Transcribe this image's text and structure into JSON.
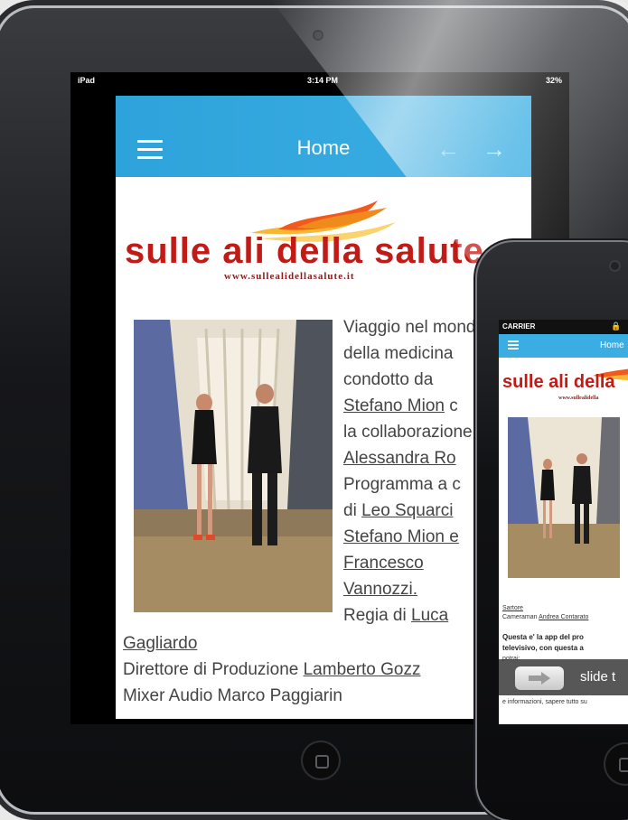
{
  "ipad": {
    "status": {
      "carrier": "iPad",
      "time": "3:14 PM",
      "battery": "32%"
    },
    "nav": {
      "title": "Home",
      "back_icon": "arrow-left-icon",
      "forward_icon": "arrow-right-icon",
      "menu_icon": "hamburger-menu-icon"
    },
    "logo": {
      "text": "sulle ali della salute",
      "url": "www.sullealidellasalute.it"
    },
    "body": {
      "line1": "Viaggio nel mondo",
      "line2": "della medicina",
      "line3": "condotto da",
      "line4_link": "Stefano Mion",
      "line4_suffix": " c",
      "line5": "la collaborazione",
      "line6_link": "Alessandra Ro",
      "line7": "Programma a c",
      "line8_prefix": "di ",
      "line8_link": "Leo Squarci",
      "line9_link": "Stefano Mion e",
      "line10_link": "Francesco",
      "line11_link": "Vannozzi.",
      "line12_prefix": "Regia di ",
      "line12_link": "Luca",
      "line13_link": "Gagliardo",
      "line14_prefix": "Direttore di Produzione ",
      "line14_link": "Lamberto Gozz",
      "line15": "Mixer Audio Marco Paggiarin"
    },
    "colors": {
      "navbar": "#2ea3db",
      "logo_red": "#c11b17"
    }
  },
  "iphone": {
    "status": {
      "carrier": "CARRIER"
    },
    "nav": {
      "title": "Home"
    },
    "logo": {
      "text": "sulle ali della",
      "url": "www.sullealidella"
    },
    "body": {
      "sartore": "Sartore",
      "cameraman_prefix": "Cameraman ",
      "cameraman_link": "Andrea Contarato",
      "bold_line1": "Questa e' la app del pro",
      "bold_line2": "televisivo, con questa a",
      "small_line1": "potrai:",
      "small_line2": "e informazioni, sapere tutto su"
    },
    "slide": {
      "text": "slide t",
      "icon": "arrow-right-icon"
    }
  }
}
